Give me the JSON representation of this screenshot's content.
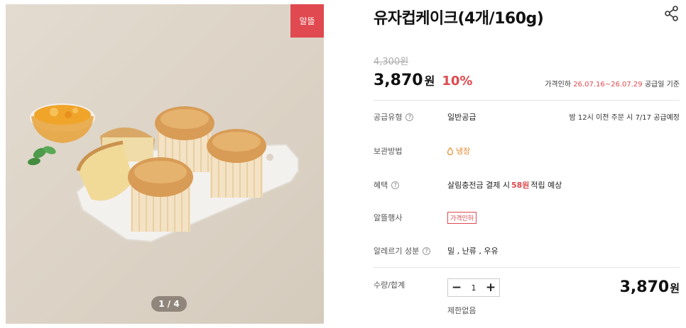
{
  "gallery": {
    "badge": "알뜰",
    "pager": "1 / 4"
  },
  "product": {
    "title": "유자컵케이크(4개/160g)",
    "original_price": "4,300원",
    "price": "3,870",
    "price_unit": "원",
    "discount": "10%",
    "sale_period": {
      "prefix": "가격인하 ",
      "dates": "26.07.16~26.07.29",
      "suffix": " 공급일 기준"
    }
  },
  "details": {
    "supply_type": {
      "label": "공급유형",
      "value": "일반공급",
      "note": "밤 12시 이전 주문 시 7/17 공급예정"
    },
    "storage": {
      "label": "보관방법",
      "value": "냉장"
    },
    "benefit": {
      "label": "혜택",
      "prefix": "살림충전금 결제 시 ",
      "points": "58원",
      "suffix": " 적립 예상"
    },
    "event": {
      "label": "알뜰행사",
      "tag": "가격인하"
    },
    "allergy": {
      "label": "알레르기 성분",
      "value": "밀 , 난류 , 우유"
    }
  },
  "order": {
    "label": "수량/합계",
    "minus": "−",
    "quantity": "1",
    "plus": "+",
    "total": "3,870",
    "total_unit": "원",
    "limit": "제한없음"
  },
  "colors": {
    "accent": "#e0494f",
    "storage": "#e58a2c"
  },
  "icons": {
    "share": "share-icon",
    "help": "question-circle-icon",
    "storage": "water-drop-icon"
  }
}
